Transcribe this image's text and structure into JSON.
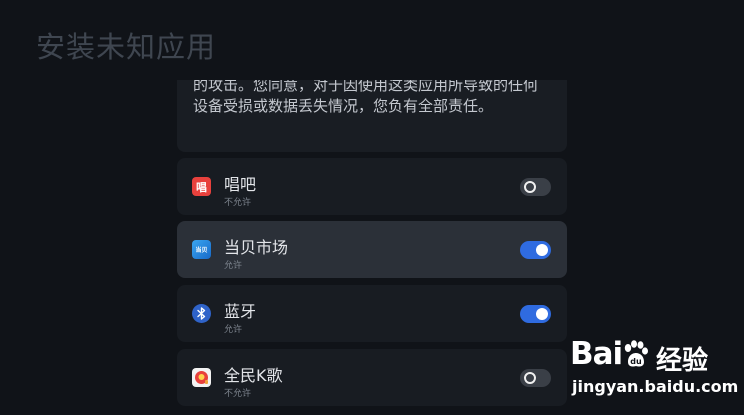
{
  "header": {
    "title": "安装未知应用"
  },
  "notice": {
    "text": "的攻击。您同意，对于因使用这类应用所导致的任何设备受损或数据丢失情况，您负有全部责任。"
  },
  "apps": [
    {
      "name": "唱吧",
      "status": "不允许",
      "enabled": false,
      "icon": "changba-app-icon",
      "icon_glyph": "唱"
    },
    {
      "name": "当贝市场",
      "status": "允许",
      "enabled": true,
      "icon": "dangbei-market-app-icon",
      "icon_glyph": "当贝"
    },
    {
      "name": "蓝牙",
      "status": "允许",
      "enabled": true,
      "icon": "bluetooth-app-icon",
      "icon_glyph": ""
    },
    {
      "name": "全民K歌",
      "status": "不允许",
      "enabled": false,
      "icon": "quanmin-kge-app-icon",
      "icon_glyph": ""
    }
  ],
  "focused_index": 1,
  "watermark": {
    "logo_text": "Bai",
    "logo_suffix": "经验",
    "url": "jingyan.baidu.com"
  },
  "colors": {
    "background": "#101318",
    "row": "#181c22",
    "row_focused": "#2b3038",
    "toggle_on": "#2f6be0",
    "toggle_off": "#3a3f47"
  }
}
